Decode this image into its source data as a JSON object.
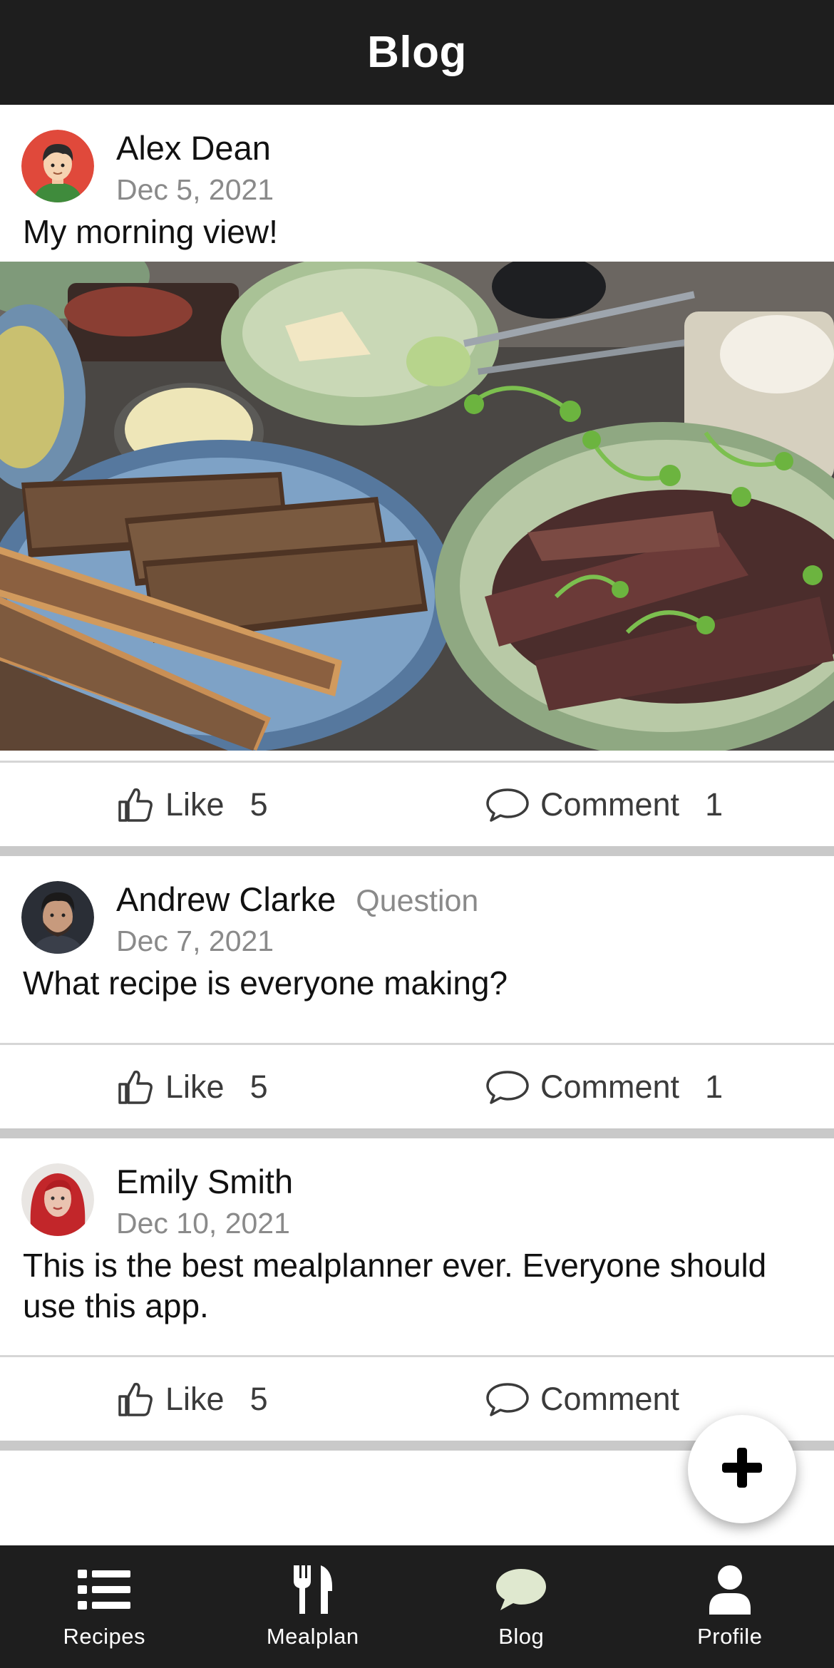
{
  "header": {
    "title": "Blog"
  },
  "posts": [
    {
      "author": "Alex Dean",
      "tag": "",
      "date": "Dec 5, 2021",
      "text": "My morning view!",
      "like_label": "Like",
      "likes": "5",
      "comment_label": "Comment",
      "comments": "1"
    },
    {
      "author": "Andrew Clarke",
      "tag": "Question",
      "date": "Dec 7, 2021",
      "text": "What recipe is everyone making?",
      "like_label": "Like",
      "likes": "5",
      "comment_label": "Comment",
      "comments": "1"
    },
    {
      "author": "Emily Smith",
      "tag": "",
      "date": "Dec 10, 2021",
      "text": "This is the best mealplanner ever. Everyone should use this app.",
      "like_label": "Like",
      "likes": "5",
      "comment_label": "Comment",
      "comments": ""
    }
  ],
  "fab": {
    "icon": "plus-icon"
  },
  "tabbar": {
    "items": [
      {
        "label": "Recipes",
        "icon": "list-icon"
      },
      {
        "label": "Mealplan",
        "icon": "fork-knife-icon"
      },
      {
        "label": "Blog",
        "icon": "chat-bubble-icon",
        "active": true
      },
      {
        "label": "Profile",
        "icon": "person-icon"
      }
    ]
  },
  "colors": {
    "bar_bg": "#1e1e1e",
    "active_tab_icon": "#dfe8cf",
    "muted_text": "#8a8a8a",
    "separator": "#c9c9c9"
  }
}
